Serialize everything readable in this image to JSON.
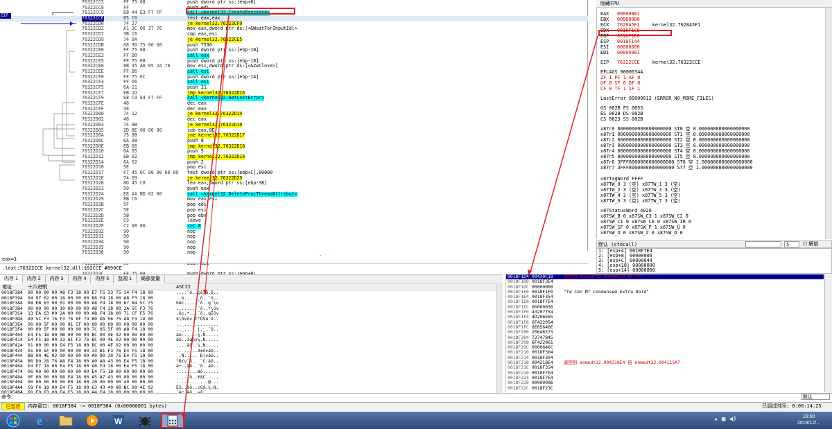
{
  "cpu": {
    "eip_label": "EIP",
    "rows": [
      {
        "a": "76322CC5",
        "h": "FF 75 08",
        "i": "push dword ptr ss:[ebp+8]",
        "k": "push"
      },
      {
        "a": "76322CC8",
        "h": "FF",
        "i": "push edi",
        "k": "push"
      },
      {
        "a": "76322CC9",
        "h": "E8 A4 E3 F7 FF",
        "i": "call <kernel32.CreateProcessA>",
        "k": "call"
      },
      {
        "a": "76322CCE",
        "h": "85 C0",
        "i": "test eax,eax",
        "k": "",
        "sel": true
      },
      {
        "a": "76322CD0",
        "h": "74 27",
        "i": "je kernel32.76322CF9",
        "k": "je"
      },
      {
        "a": "76322CD2",
        "h": "A1 3C 00 37 76",
        "i": "mov eax,dword ptr ds:[<&WaitForInputIdl>",
        "k": ""
      },
      {
        "a": "76322CD7",
        "h": "3B C6",
        "i": "cmp eax,esi",
        "k": ""
      },
      {
        "a": "76322CD9",
        "h": "74 0A",
        "i": "je kernel32.76322CE5",
        "k": "je"
      },
      {
        "a": "76322CDB",
        "h": "68 30 75 00 00",
        "i": "push 7530",
        "k": "push"
      },
      {
        "a": "76322CE0",
        "h": "FF 75 E8",
        "i": "push dword ptr ss:[ebp-18]",
        "k": "push"
      },
      {
        "a": "76322CE3",
        "h": "FF D0",
        "i": "call eax",
        "k": "call"
      },
      {
        "a": "76322CE5",
        "h": "FF 75 E8",
        "i": "push dword ptr ss:[ebp-18]",
        "k": "push"
      },
      {
        "a": "76322CE8",
        "h": "8B 35 A0 05 2A 76",
        "i": "mov esi,dword ptr ds:[<&ZwClose>]",
        "k": ""
      },
      {
        "a": "76322CEE",
        "h": "FF D6",
        "i": "call esi",
        "k": "call"
      },
      {
        "a": "76322CF0",
        "h": "FF 75 EC",
        "i": "push dword ptr ss:[ebp-14]",
        "k": "push"
      },
      {
        "a": "76322CF3",
        "h": "FF D6",
        "i": "call esi",
        "k": "call"
      },
      {
        "a": "76322CF5",
        "h": "6A 21",
        "i": "push 21",
        "k": "push"
      },
      {
        "a": "76322CF7",
        "h": "EB 1D",
        "i": "jmp kernel32.76322D16",
        "k": "jmp"
      },
      {
        "a": "76322CF9",
        "h": "E8 C9 E4 F7 FF",
        "i": "call <kernel32.GetLastError>",
        "k": "call"
      },
      {
        "a": "76322CFE",
        "h": "48",
        "i": "dec eax",
        "k": ""
      },
      {
        "a": "76322CFF",
        "h": "48",
        "i": "dec eax",
        "k": ""
      },
      {
        "a": "76322D00",
        "h": "74 12",
        "i": "je kernel32.76322D14",
        "k": "je"
      },
      {
        "a": "76322D02",
        "h": "48",
        "i": "dec eax",
        "k": ""
      },
      {
        "a": "76322D03",
        "h": "74 0B",
        "i": "je kernel32.76322D10",
        "k": "je"
      },
      {
        "a": "76322D05",
        "h": "2D 8E 00 00 00",
        "i": "sub eax,8E",
        "k": ""
      },
      {
        "a": "76322D0A",
        "h": "75 0B",
        "i": "jne kernel32.76322D17",
        "k": "je"
      },
      {
        "a": "76322D0C",
        "h": "6A 08",
        "i": "push 8",
        "k": "push"
      },
      {
        "a": "76322D0E",
        "h": "EB 06",
        "i": "jmp kernel32.76322D16",
        "k": "jmp"
      },
      {
        "a": "76322D10",
        "h": "6A 05",
        "i": "push 5",
        "k": "push"
      },
      {
        "a": "76322D12",
        "h": "EB 02",
        "i": "jmp kernel32.76322D16",
        "k": "jmp"
      },
      {
        "a": "76322D14",
        "h": "6A 02",
        "i": "push 2",
        "k": "push"
      },
      {
        "a": "76322D16",
        "h": "5E",
        "i": "pop esi",
        "k": ""
      },
      {
        "a": "76322D17",
        "h": "F7 45 0C 00 00 08 00",
        "i": "test dword ptr ss:[ebp+C],80000",
        "k": ""
      },
      {
        "a": "76322D1E",
        "h": "74 09",
        "i": "je kernel32.76322D29",
        "k": "je"
      },
      {
        "a": "76322D20",
        "h": "8D 45 C8",
        "i": "lea eax,dword ptr ss:[ebp-38]",
        "k": ""
      },
      {
        "a": "76322D23",
        "h": "50",
        "i": "push eax",
        "k": "push"
      },
      {
        "a": "76322D24",
        "h": "E8 AA BD 02 00",
        "i": "call <kernel32.DeleteProcThreadAttribut>",
        "k": "call"
      },
      {
        "a": "76322D29",
        "h": "8B C6",
        "i": "mov eax,esi",
        "k": ""
      },
      {
        "a": "76322D2B",
        "h": "5F",
        "i": "pop edi",
        "k": ""
      },
      {
        "a": "76322D2C",
        "h": "5E",
        "i": "pop esi",
        "k": ""
      },
      {
        "a": "76322D2D",
        "h": "5B",
        "i": "pop ebx",
        "k": ""
      },
      {
        "a": "76322D2E",
        "h": "C9",
        "i": "leave",
        "k": ""
      },
      {
        "a": "76322D2F",
        "h": "C2 08 00",
        "i": "ret 8",
        "k": "ret"
      },
      {
        "a": "76322D32",
        "h": "90",
        "i": "nop",
        "k": "nop"
      },
      {
        "a": "76322D33",
        "h": "90",
        "i": "nop",
        "k": "nop"
      },
      {
        "a": "76322D34",
        "h": "90",
        "i": "nop",
        "k": "nop"
      },
      {
        "a": "76322D35",
        "h": "90",
        "i": "nop",
        "k": "nop"
      },
      {
        "a": "76322D36",
        "h": "90",
        "i": "nop",
        "k": "nop"
      },
      {
        "a": "76322D37",
        "h": "8B FF",
        "i": "mov edi,edi",
        "k": "",
        "c": "FatalExit"
      },
      {
        "a": "76322D39",
        "h": "55",
        "i": "push ebp",
        "k": "push"
      },
      {
        "a": "76322D3A",
        "h": "8B EC",
        "i": "mov ebp,esp",
        "k": ""
      },
      {
        "a": "76322D3C",
        "h": "FF 75 08",
        "i": "push dword ptr ss:[ebp+8]",
        "k": "push"
      }
    ]
  },
  "regs": {
    "tab": "隐藏FPU",
    "gp": [
      {
        "n": "EAX",
        "v": "00000001",
        "c": ""
      },
      {
        "n": "EBX",
        "v": "00000000",
        "c": ""
      },
      {
        "n": "ECX",
        "v": "7628A5F1",
        "c": "kernel32.7628A5F1"
      },
      {
        "n": "EDX",
        "v": "0018F1C8",
        "c": ""
      },
      {
        "n": "EBP",
        "v": "0018F1D0",
        "c": ""
      },
      {
        "n": "ESP",
        "v": "0018F144",
        "c": ""
      },
      {
        "n": "ESI",
        "v": "00000000",
        "c": ""
      },
      {
        "n": "EDI",
        "v": "00000001",
        "c": ""
      }
    ],
    "eip": {
      "n": "EIP",
      "v": "76322CCE",
      "c": "kernel32.76322CCE"
    },
    "eflags": "EFLAGS   00000344",
    "flags": [
      "ZF 1  PF 1  AF 0",
      "OF 0  SF 0  DF 0",
      "CF 0  TF 1  IF 1"
    ],
    "lasterr": "LastError 00000012 (ERROR_NO_MORE_FILES)",
    "segs": [
      "GS 002B  FS 0053",
      "ES 002B  DS 002B",
      "CS 0023  SS 002B"
    ],
    "fpu": [
      "x87r0 0000000000000000000 ST0 空 0.000000000000000000",
      "x87r1 0000000000000000000 ST1 空 0.000000000000000000",
      "x87r2 0000000000000000000 ST2 空 0.000000000000000000",
      "x87r3 0000000000000000000 ST3 空 0.000000000000000000",
      "x87r4 0000000000000000000 ST4 空 0.000000000000000000",
      "x87r5 0000000000000000000 ST5 空 0.000000000000000000",
      "x87r6 3FFF8000000000000000 ST6 空 1.000000000000000000",
      "x87r7 3FFF8000000000000000 ST7 空 1.000000000000000000"
    ],
    "tag": [
      "x87TagWord FFFF",
      "x87TW_0 3 (空)      x87TW_1 3 (空)",
      "x87TW_2 3 (空)      x87TW_3 3 (空)",
      "x87TW_4 3 (空)      x87TW_5 3 (空)",
      "x87TW_6 3 (空)      x87TW_7 3 (空)"
    ],
    "status": [
      "x87StatusWord 4020",
      "x87SW_B  0  x87SW_C3  1  x87SW_C2  0",
      "x87SW_C1 0  x87SW_C0  0  x87SW_IR  0",
      "x87SW_SF 0  x87SW_P   1  x87SW_U   0",
      "x87SW_O  0  x87SW_Z   0  x87SW_D   0",
      "x87SW_I  0  x87SW_TOP 0  (ST0=x87r0)"
    ]
  },
  "stackmini": {
    "conv": "默认 (stdcall)",
    "count": "5",
    "unlock": "解锁",
    "lines": [
      "1: [esp+4] 0018F7E4",
      "2: [esp+8] 00000006",
      "3: [esp+C] 00000044",
      "4: [esp+10] 00000000",
      "5: [esp+14] 00000000"
    ]
  },
  "info": {
    "line1": "eax=1",
    "line2": ".text:76322CCE kernel32.dll:$92CCE #890CE"
  },
  "dump": {
    "tabs": [
      "内存 1",
      "内存 2",
      "内存 3",
      "内存 4",
      "内存 5",
      "监视 1",
      "局部变量"
    ],
    "h_addr": "地址",
    "h_hex": "十六进制",
    "h_ascii": "ASCII",
    "rows": [
      {
        "a": "0018F384",
        "h": "00 00 00 00 A8 F3 18 00 E7 F5 33 75 14 F4 18 00",
        "s": "....¨ó..çõ3u.ô.."
      },
      {
        "a": "0018F394",
        "h": "04 97 62 00 18 00 00 00 B8 F4 18 00 A8 F3 18 00",
        "s": "..b.....¸ô..¨ó.."
      },
      {
        "a": "0018F3A4",
        "h": "68 EB 63 00 01 00 00 00 A8 F4 18 00 67 B4 5C 75",
        "s": "hëc.....¨ô..g´\\u"
      },
      {
        "a": "0018F3B4",
        "h": "00 00 00 00 10 00 00 00 A8 F4 18 00 2A 5C F3 76",
        "s": "........¨ô..*\\óv"
      },
      {
        "a": "0018F3C4",
        "h": "13 EA 63 00 2A 00 00 00 A8 F4 18 00 71 CF F5 76",
        "s": ".êc.*...¨ô..qÏõv"
      },
      {
        "a": "0018F3D4",
        "h": "A3 5C F3 76 F3 76 8F 74 B0 DA 56 75 A8 F3 18 00",
        "s": "£\\óvóv.t°ÚVu¨ó.."
      },
      {
        "a": "0018F3E4",
        "h": "00 00 5F 00 00 01 5F 00 00 00 00 00 00 00 00 00",
        "s": ".._..._........."
      },
      {
        "a": "0018F3F4",
        "h": "00 00 5F 00 00 00 00 00 7C 05 5F 00 A8 F4 18 00",
        "s": ".._.....|._.¨ô.."
      },
      {
        "a": "0018F404",
        "h": "E4 F5 18 00 0B 00 00 00 BC 00 4E 02 00 00 00 00",
        "s": "äõ......¼.N....."
      },
      {
        "a": "0018F414",
        "h": "E4 F5 18 00 33 61 F3 76 BC 00 4E 02 00 00 00 00",
        "s": "äõ..3aóv¼.N....."
      },
      {
        "a": "0018F424",
        "h": "01 00 00 00 E4 F5 18 00 BC 00 4E 02 00 00 00 00",
        "s": "....äõ..¼.N....."
      },
      {
        "a": "0018F434",
        "h": "01 00 5F 00 00 00 00 00 33 B1 F3 76 E4 F5 18 00",
        "s": ".._.....3±óväõ.."
      },
      {
        "a": "0018F444",
        "h": "B8 00 4E 02 00 00 00 00 A0 D0 28 76 E4 F5 18 00",
        "s": "¸.N..... Ð(väõ.."
      },
      {
        "a": "0018F454",
        "h": "B0 D0 28 76 A8 F4 18 00 A0 A8 43 00 E4 F5 18 00",
        "s": "°Ð(v¨ô.. ¨C.äõ.."
      },
      {
        "a": "0018F464",
        "h": "E4 F7 18 00 E4 F5 18 00 A8 F4 18 00 E4 F5 18 00",
        "s": "ä÷..äõ..¨ô..äõ.."
      },
      {
        "a": "0018F474",
        "h": "06 00 00 00 00 00 00 00 E4 F5 18 00 00 00 00 00",
        "s": "........äõ......"
      },
      {
        "a": "0018F484",
        "h": "0F 00 00 00 88 F4 18 00 A5 A7 43 00 00 00 00 00",
        "s": "....ˆô..¥§C....."
      },
      {
        "a": "0018F494",
        "h": "00 00 00 00 00 00 18 00 20 00 00 00 40 00 00 00",
        "s": "........ ...@..."
      },
      {
        "a": "0018F4A4",
        "h": "C8 F4 18 00 E4 F5 18 00 63 43 40 00 BC 00 4E 02",
        "s": "Èô..äõ..cC@.¼.N."
      },
      {
        "a": "0018F4B4",
        "h": "60 E9 63 00 E4 F5 18 00 A4 F4 18 00 00 00 00 00",
        "s": "`éc.äõ..¤ô......"
      },
      {
        "a": "0018F4C4",
        "h": "7A 42 62 00 E4 F4 18 00 4B 8E 50 75 00 00 00 00",
        "s": "zBb.äô..K.Pu...."
      }
    ]
  },
  "stack": {
    "rows": [
      {
        "a": "0018F1D4",
        "v": "00430C18",
        "c": "返回到 eomedt32.00430C18 自 ???"
      },
      {
        "a": "0018F1D8",
        "v": "0018F3E4",
        "c": ""
      },
      {
        "a": "0018F1DC",
        "v": "00000000",
        "c": ""
      },
      {
        "a": "0018F1E0",
        "v": "0018F1F0",
        "c": "\"Tw Cen MT Condensed Extra Bold\""
      },
      {
        "a": "0018F1E4",
        "v": "0018F354",
        "c": ""
      },
      {
        "a": "0018F1E8",
        "v": "0018F7E4",
        "c": ""
      },
      {
        "a": "0018F1EC",
        "v": "00000036",
        "c": ""
      },
      {
        "a": "0018F1F0",
        "v": "43207754",
        "c": ""
      },
      {
        "a": "0018F1F4",
        "v": "4D206E65",
        "c": ""
      },
      {
        "a": "0018F1F8",
        "v": "6F432054",
        "c": ""
      },
      {
        "a": "0018F1FC",
        "v": "6E65646E",
        "c": ""
      },
      {
        "a": "0018F200",
        "v": "20646573",
        "c": ""
      },
      {
        "a": "0018F204",
        "v": "72747845",
        "c": ""
      },
      {
        "a": "0018F208",
        "v": "6F422061",
        "c": ""
      },
      {
        "a": "0018F20C",
        "v": "0000646C",
        "c": ""
      },
      {
        "a": "0018F210",
        "v": "0018F304",
        "c": ""
      },
      {
        "a": "0018F214",
        "v": "0018F304",
        "c": ""
      },
      {
        "a": "0018F218",
        "v": "004218E4",
        "c": "返回到 eomedt32.004218E4 自 eomedt32.004115A7"
      },
      {
        "a": "0018F21C",
        "v": "0018F354",
        "c": ""
      },
      {
        "a": "0018F220",
        "v": "0018F7E4",
        "c": ""
      },
      {
        "a": "0018F224",
        "v": "0018F7E4",
        "c": ""
      },
      {
        "a": "0018F228",
        "v": "00000006",
        "c": ""
      },
      {
        "a": "0018F22C",
        "v": "0018F23C",
        "c": ""
      }
    ]
  },
  "cmd": {
    "label": "命令：",
    "mode": "默认"
  },
  "status": {
    "paused": "已暂停",
    "msg": "内存窗口: 0018F384 -> 0018F384 (0x00000001 bytes)",
    "right": "已调试时间:  0:00:14:25"
  },
  "clock": {
    "time": "16:50",
    "date": "2019/12/..."
  },
  "colors": {
    "accent": "#00008b",
    "annotation": "#e02020",
    "call_bg": "#00ffff",
    "jump_bg": "#ffff00"
  }
}
